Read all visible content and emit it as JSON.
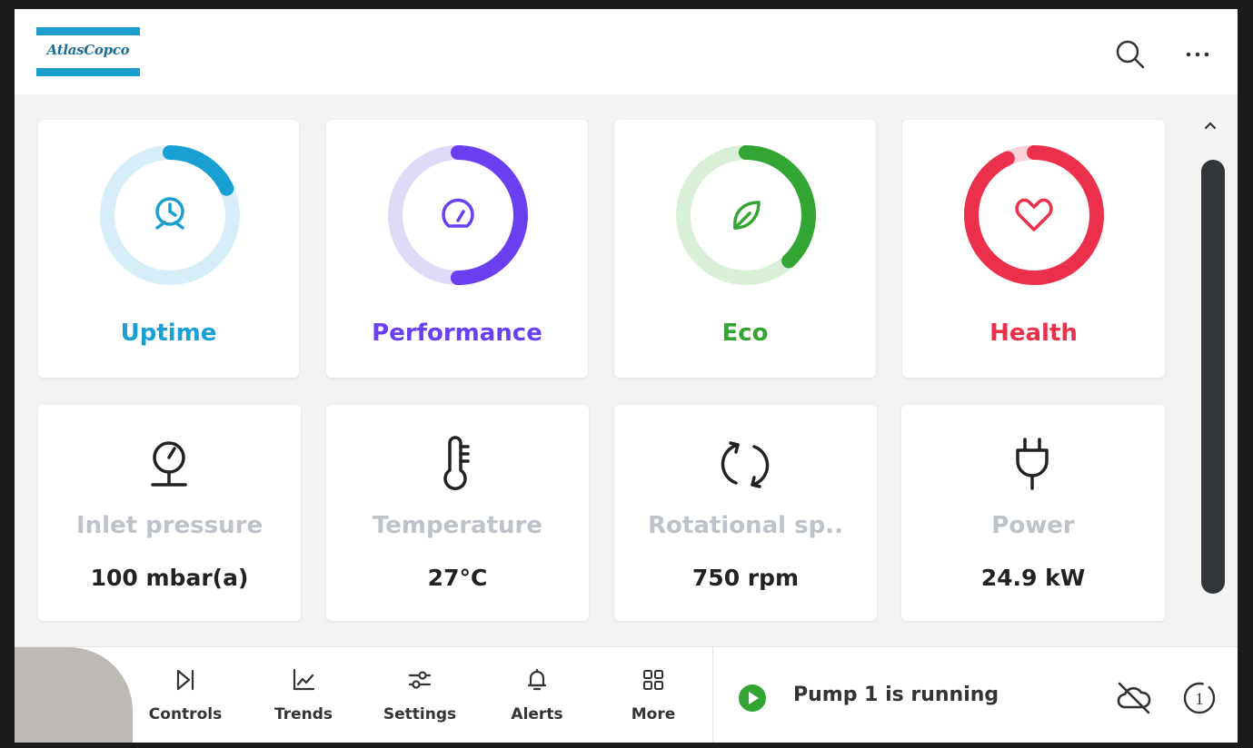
{
  "brand": {
    "logo_text": "AtlasCopco",
    "color": "#1b9ecd"
  },
  "header": {
    "search_icon": "search-icon",
    "more_icon": "more-horizontal-icon"
  },
  "kpis": [
    {
      "label": "Uptime",
      "icon": "clock-icon",
      "color": "#1a9fd2",
      "track": "#d6eef8",
      "progress": 0.18
    },
    {
      "label": "Performance",
      "icon": "gauge-icon",
      "color": "#6a3ff0",
      "track": "#e0daf8",
      "progress": 0.5
    },
    {
      "label": "Eco",
      "icon": "leaf-icon",
      "color": "#33a532",
      "track": "#d9efd7",
      "progress": 0.38
    },
    {
      "label": "Health",
      "icon": "heart-icon",
      "color": "#ec2f4b",
      "track": "#fad2d8",
      "progress": 0.93
    }
  ],
  "metrics": [
    {
      "label": "Inlet pressure",
      "value": "100 mbar(a)",
      "icon": "pressure-gauge-icon"
    },
    {
      "label": "Temperature",
      "value": "27°C",
      "icon": "thermometer-icon"
    },
    {
      "label": "Rotational sp..",
      "value": "750 rpm",
      "icon": "rotation-icon"
    },
    {
      "label": "Power",
      "value": "24.9 kW",
      "icon": "plug-icon"
    }
  ],
  "nav": {
    "items": [
      {
        "label": "Controls",
        "icon": "controls-icon"
      },
      {
        "label": "Trends",
        "icon": "trends-icon"
      },
      {
        "label": "Settings",
        "icon": "sliders-icon"
      },
      {
        "label": "Alerts",
        "icon": "bell-icon"
      },
      {
        "label": "More",
        "icon": "grid-icon"
      }
    ]
  },
  "status": {
    "text": "Pump 1 is running",
    "color": "#33a532",
    "cloud_icon": "cloud-off-icon",
    "badge_icon": "info-1-icon",
    "badge_text": "1"
  }
}
